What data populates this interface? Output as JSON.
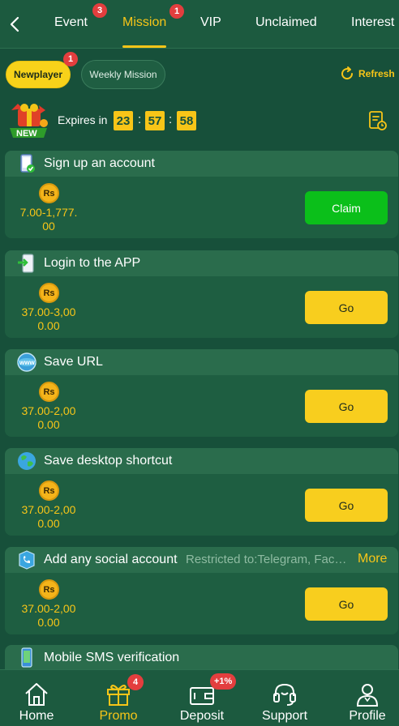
{
  "top_tabs": [
    {
      "label": "Event",
      "badge": "3"
    },
    {
      "label": "Mission",
      "badge": "1",
      "active": true
    },
    {
      "label": "VIP"
    },
    {
      "label": "Unclaimed"
    },
    {
      "label": "Interest"
    }
  ],
  "subbar": {
    "newplayer": {
      "label": "Newplayer",
      "badge": "1"
    },
    "weekly": {
      "label": "Weekly Mission"
    },
    "refresh_label": "Refresh"
  },
  "expires": {
    "label": "Expires in",
    "hours": "23",
    "minutes": "57",
    "seconds": "58",
    "separator": ":",
    "gift_text": "NEW"
  },
  "currency_symbol": "Rs",
  "missions": [
    {
      "title": "Sign up an account",
      "amount_line1": "7.00-1,777.",
      "amount_line2": "00",
      "button": "Claim",
      "icon": "phone-check-icon"
    },
    {
      "title": "Login to the APP",
      "amount_line1": "37.00-3,00",
      "amount_line2": "0.00",
      "button": "Go",
      "icon": "app-login-icon"
    },
    {
      "title": "Save URL",
      "amount_line1": "37.00-2,00",
      "amount_line2": "0.00",
      "button": "Go",
      "icon": "www-globe-icon"
    },
    {
      "title": "Save desktop shortcut",
      "amount_line1": "37.00-2,00",
      "amount_line2": "0.00",
      "button": "Go",
      "icon": "earth-icon"
    },
    {
      "title": "Add any social account",
      "restriction": "Restricted to:Telegram, Facebook",
      "more": "More",
      "amount_line1": "37.00-2,00",
      "amount_line2": "0.00",
      "button": "Go",
      "icon": "social-phone-icon"
    },
    {
      "title": "Mobile SMS verification",
      "icon": "mobile-sms-icon"
    }
  ],
  "bottom_nav": [
    {
      "label": "Home",
      "icon": "home-icon"
    },
    {
      "label": "Promo",
      "icon": "gift-icon",
      "badge": "4",
      "active": true
    },
    {
      "label": "Deposit",
      "icon": "wallet-icon",
      "badge": "+1%"
    },
    {
      "label": "Support",
      "icon": "headset-icon"
    },
    {
      "label": "Profile",
      "icon": "person-icon"
    }
  ],
  "colors": {
    "background": "#17503a",
    "accent": "#f7c518",
    "claim": "#0bbf1a",
    "badge": "#e33e3e"
  }
}
